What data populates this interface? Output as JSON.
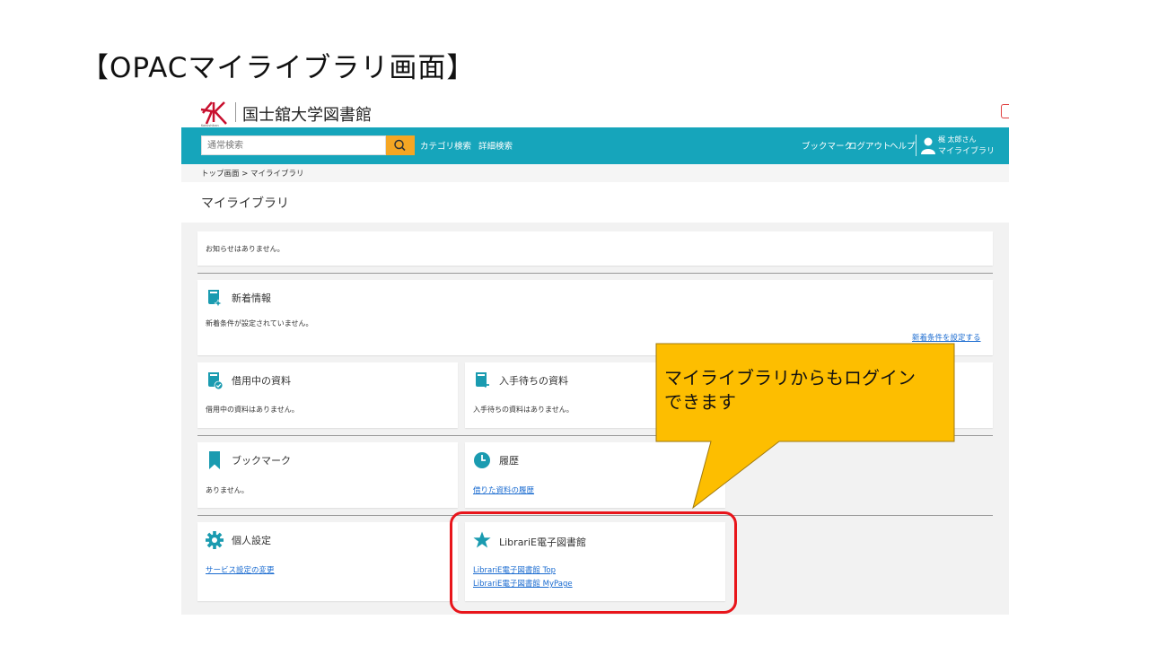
{
  "slide": {
    "title": "【OPACマイライブラリ画面】"
  },
  "header": {
    "library_name": "国士舘大学図書館"
  },
  "search": {
    "placeholder": "通常検索"
  },
  "nav": {
    "category_search": "カテゴリ検索",
    "advanced_search": "詳細検索",
    "bookmark": "ブックマーク",
    "logout": "ログアウト",
    "help": "ヘルプ",
    "user_name": "梶 太郎さん",
    "my_library": "マイライブラリ"
  },
  "breadcrumb": {
    "text": "トップ画面 > マイライブラリ"
  },
  "page": {
    "title": "マイライブラリ"
  },
  "notice": {
    "text": "お知らせはありません。"
  },
  "new_info": {
    "title": "新着情報",
    "text": "新着条件が設定されていません。",
    "link": "新着条件を設定する"
  },
  "borrowing": {
    "title": "借用中の資料",
    "text": "借用中の資料はありません。"
  },
  "awaiting": {
    "title": "入手待ちの資料",
    "text": "入手待ちの資料はありません。"
  },
  "bookmarks": {
    "title": "ブックマーク",
    "text": "ありません。"
  },
  "history": {
    "title": "履歴",
    "link": "借りた資料の履歴"
  },
  "settings": {
    "title": "個人設定",
    "link": "サービス設定の変更"
  },
  "librarie": {
    "title": "LibrariE電子図書館",
    "link_top": "LibrariE電子図書館 Top",
    "link_mypage": "LibrariE電子図書館 MyPage"
  },
  "callout": {
    "line1": "マイライブラリからもログイン",
    "line2": "できます"
  },
  "colors": {
    "nav_bg": "#16a5bb",
    "search_button": "#f5a623",
    "icon": "#1a9bb0",
    "callout_bg": "#fdbe00",
    "highlight": "#e8151b",
    "link": "#1a6bd0"
  }
}
